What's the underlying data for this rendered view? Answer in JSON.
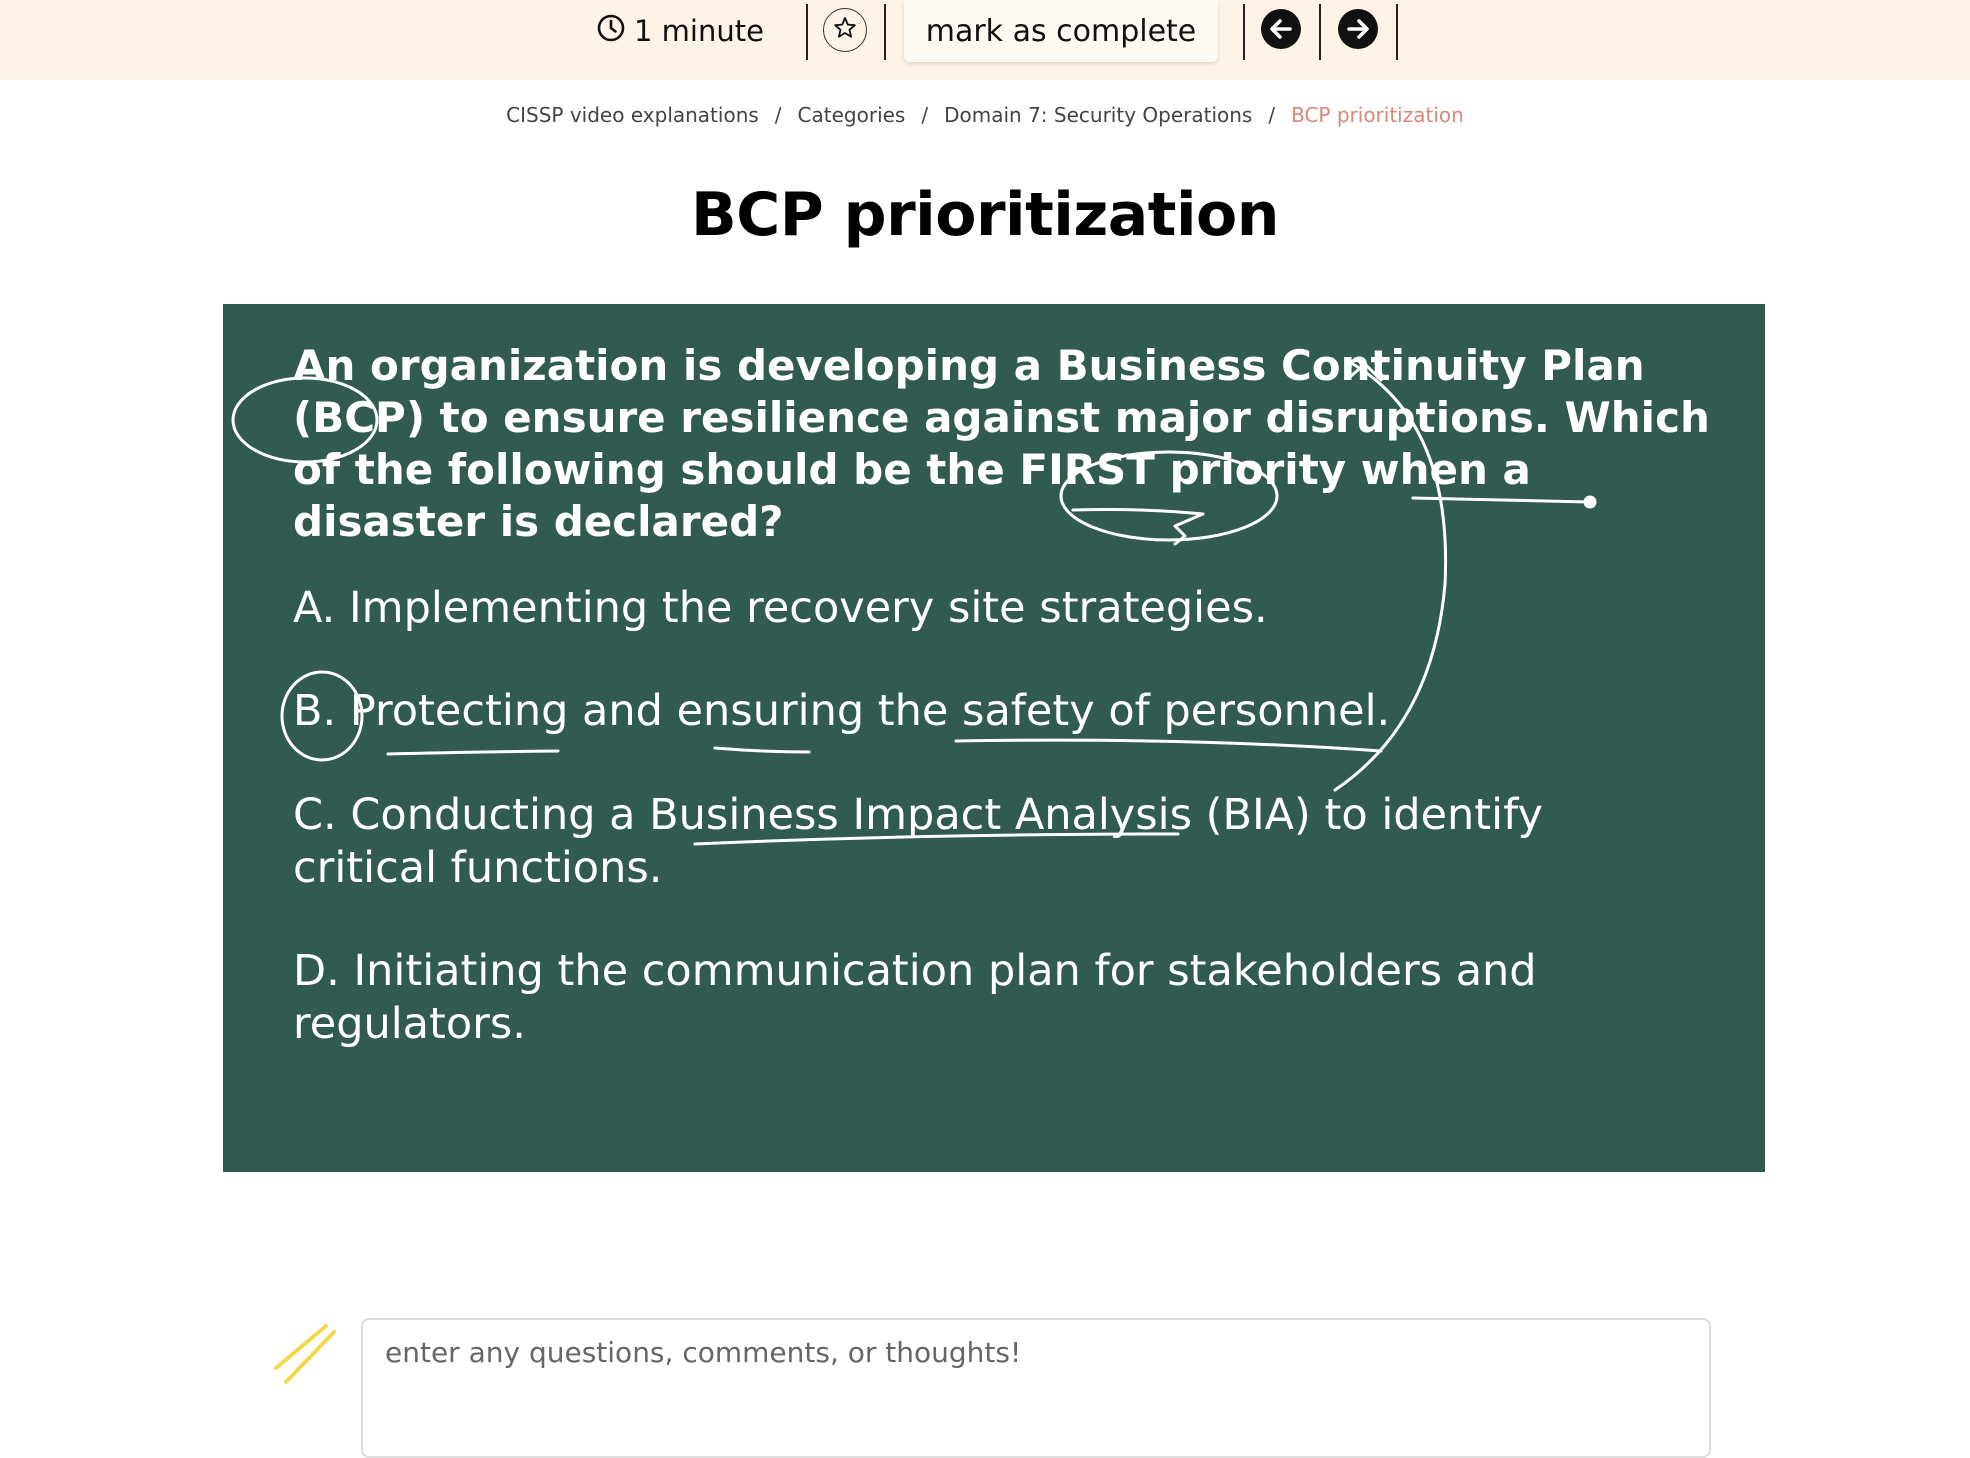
{
  "topbar": {
    "duration": "1 minute",
    "clock_icon": "clock-icon",
    "favorite_icon": "star-icon",
    "mark_complete_label": "mark as complete",
    "prev_icon": "arrow-left-icon",
    "next_icon": "arrow-right-icon"
  },
  "breadcrumb": [
    "CISSP video explanations",
    "Categories",
    "Domain 7: Security Operations",
    "BCP prioritization"
  ],
  "page_title": "BCP prioritization",
  "video": {
    "question": "An organization is developing a Business Continuity Plan (BCP) to ensure resilience against major disruptions. Which of the following should be the FIRST priority when a disaster is declared?",
    "options": [
      "A. Implementing the recovery site strategies.",
      "B. Protecting and ensuring the safety of personnel.",
      "C. Conducting a Business Impact Analysis (BIA) to identify critical functions.",
      "D. Initiating the communication plan for stakeholders and regulators."
    ]
  },
  "comment": {
    "placeholder": "enter any questions, comments, or thoughts!"
  },
  "colors": {
    "topbar_bg": "#fdf3e7",
    "video_bg": "#315a50",
    "breadcrumb_current": "#d9857b",
    "pencil_accent": "#f2d94b"
  }
}
